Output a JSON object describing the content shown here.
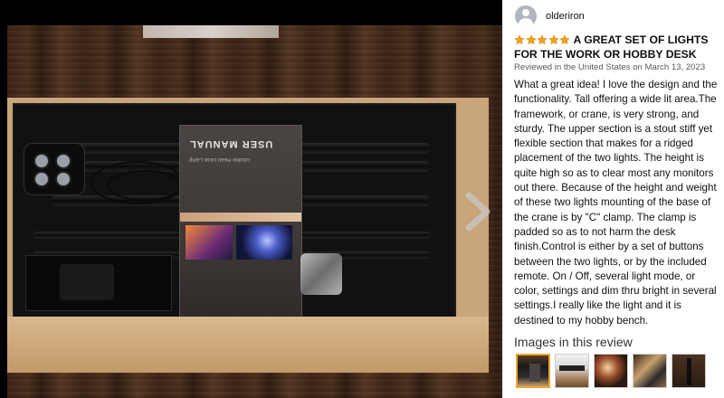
{
  "photo": {
    "manual_title": "USER MANUAL",
    "manual_subtitle": "Double Head Desk Lamp"
  },
  "review": {
    "reviewer_name": "olderiron",
    "rating": 5,
    "star_color": "#f0a11d",
    "headline": "A GREAT SET OF LIGHTS FOR THE WORK OR HOBBY DESK",
    "meta": "Reviewed in the United States on March 13, 2023",
    "body": "What a great idea! I love the design and the functionality. Tall offering a wide lit area.The framework, or crane, is very strong, and sturdy. The upper section is a stout stiff yet flexible section that makes for a ridged placement of the two lights. The height is quite high so as to clear most any monitors out there. Because of the height and weight of these two lights mounting of the base of the crane is by \"C\" clamp. The clamp is padded so as to not harm the desk finish.Control is either by a set of buttons between the two lights, or by the included remote. On / Off, several light mode, or color, settings and dim thru bright in several settings.I really like the light and it is destined to my hobby bench.",
    "images_heading": "Images in this review"
  },
  "icons": {
    "next": "chevron-right-icon",
    "avatar": "user-avatar-icon",
    "star": "star-icon"
  },
  "colors": {
    "thumb_selected_border": "#f0a530"
  }
}
